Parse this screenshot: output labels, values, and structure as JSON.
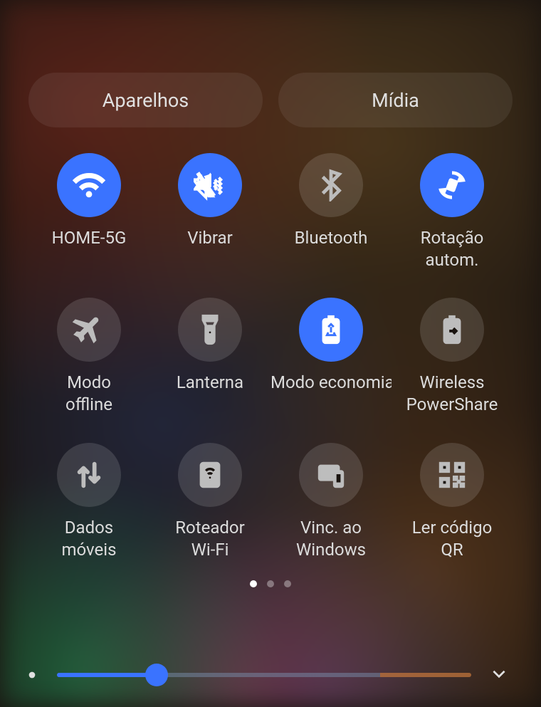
{
  "pills": {
    "devices_label": "Aparelhos",
    "media_label": "Mídia"
  },
  "tiles": [
    {
      "id": "wifi",
      "label": "HOME-5G",
      "active": true
    },
    {
      "id": "sound",
      "label": "Vibrar",
      "active": true
    },
    {
      "id": "bluetooth",
      "label": "Bluetooth",
      "active": false
    },
    {
      "id": "rotation",
      "label": "Rotação\nautom.",
      "active": true
    },
    {
      "id": "airplane",
      "label": "Modo\noffline",
      "active": false
    },
    {
      "id": "flashlight",
      "label": "Lanterna",
      "active": false
    },
    {
      "id": "battery-saver",
      "label": "Modo economia",
      "active": true
    },
    {
      "id": "power-share",
      "label": "Wireless\nPowerShare",
      "active": false
    },
    {
      "id": "mobile-data",
      "label": "Dados\nmóveis",
      "active": false
    },
    {
      "id": "hotspot",
      "label": "Roteador\nWi-Fi",
      "active": false
    },
    {
      "id": "link-windows",
      "label": "Vinc. ao\nWindows",
      "active": false
    },
    {
      "id": "qr-scanner",
      "label": "Ler código\nQR",
      "active": false
    }
  ],
  "pager": {
    "count": 3,
    "active": 0
  },
  "brightness": {
    "value": 24,
    "max": 100
  },
  "colors": {
    "accent": "#3a73ff"
  }
}
